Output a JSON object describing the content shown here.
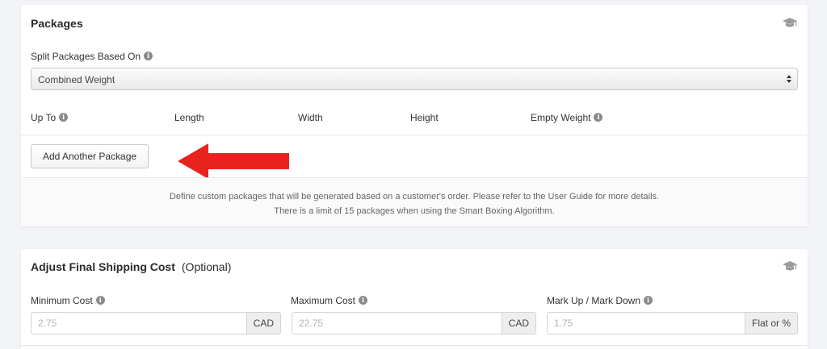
{
  "packages": {
    "title": "Packages",
    "split_label": "Split Packages Based On",
    "split_value": "Combined Weight",
    "columns": [
      "Up To",
      "Length",
      "Width",
      "Height",
      "Empty Weight"
    ],
    "add_button": "Add Another Package",
    "footnote_line1": "Define custom packages that will be generated based on a customer's order. Please refer to the User Guide for more details.",
    "footnote_line2": "There is a limit of 15 packages when using the Smart Boxing Algorithm.",
    "annotation_color": "#e8231f"
  },
  "shipping_cost": {
    "title": "Adjust Final Shipping Cost",
    "optional": "(Optional)",
    "min_label": "Minimum Cost",
    "min_placeholder": "2.75",
    "min_addon": "CAD",
    "max_label": "Maximum Cost",
    "max_placeholder": "22.75",
    "max_addon": "CAD",
    "markup_label": "Mark Up / Mark Down",
    "markup_placeholder": "1.75",
    "markup_addon": "Flat or %"
  },
  "icons": {
    "info": "i",
    "help_cap": "graduation-cap-icon",
    "select_arrows": "updown-chevron-icon",
    "annotation": "red-arrow-icon"
  }
}
